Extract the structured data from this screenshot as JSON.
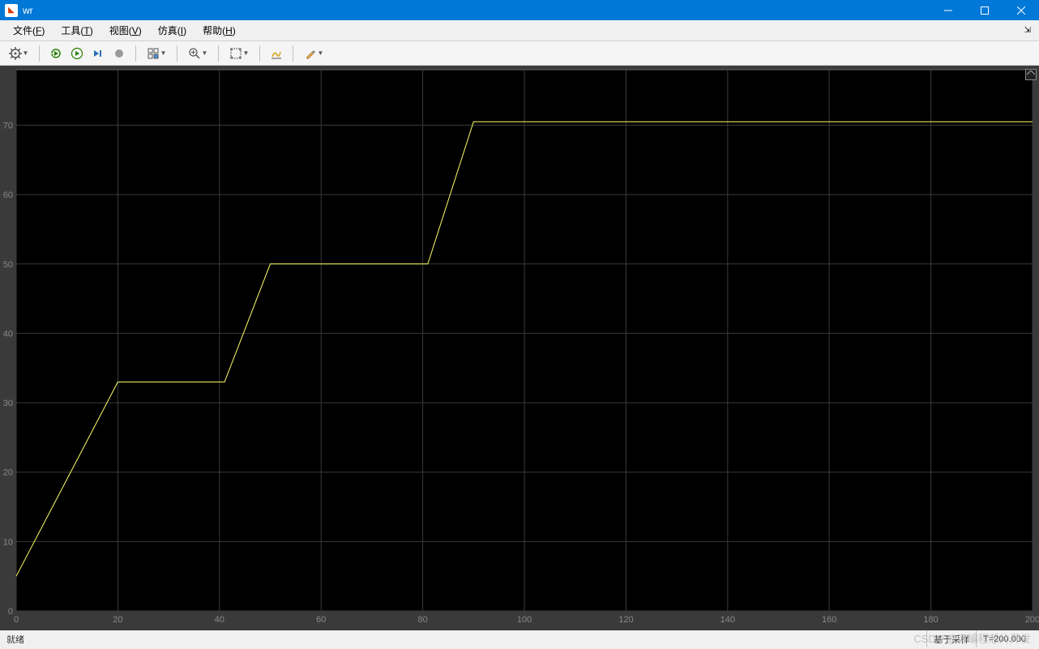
{
  "window": {
    "title": "wr",
    "app_icon_label": "📊"
  },
  "menu": {
    "items": [
      {
        "label": "文件",
        "accel": "F"
      },
      {
        "label": "工具",
        "accel": "T"
      },
      {
        "label": "视图",
        "accel": "V"
      },
      {
        "label": "仿真",
        "accel": "I"
      },
      {
        "label": "帮助",
        "accel": "H"
      }
    ]
  },
  "toolbar": {
    "groups": [
      [
        "settings-gear"
      ],
      [
        "restart",
        "play",
        "step-forward",
        "record"
      ],
      [
        "signal-select"
      ],
      [
        "zoom"
      ],
      [
        "autoscale"
      ],
      [
        "measure"
      ],
      [
        "marker"
      ]
    ]
  },
  "status": {
    "left": "就绪",
    "sample": "基于采样",
    "time": "T=200.000"
  },
  "watermark": "CSDN @可编程芯片开发",
  "chart_data": {
    "type": "line",
    "x": [
      0,
      20,
      40,
      41,
      50,
      80,
      81,
      90,
      200
    ],
    "y": [
      5,
      33,
      33,
      33,
      50,
      50,
      50,
      70.5,
      70.5
    ],
    "xlim": [
      0,
      200
    ],
    "ylim": [
      0,
      78
    ],
    "xticks": [
      0,
      20,
      40,
      60,
      80,
      100,
      120,
      140,
      160,
      180,
      200
    ],
    "yticks": [
      0,
      10,
      20,
      30,
      40,
      50,
      60,
      70
    ],
    "line_color": "#ffff66",
    "bg_color": "#000000",
    "grid_color": "#3a3a3a",
    "axis_label_color": "#888888"
  }
}
